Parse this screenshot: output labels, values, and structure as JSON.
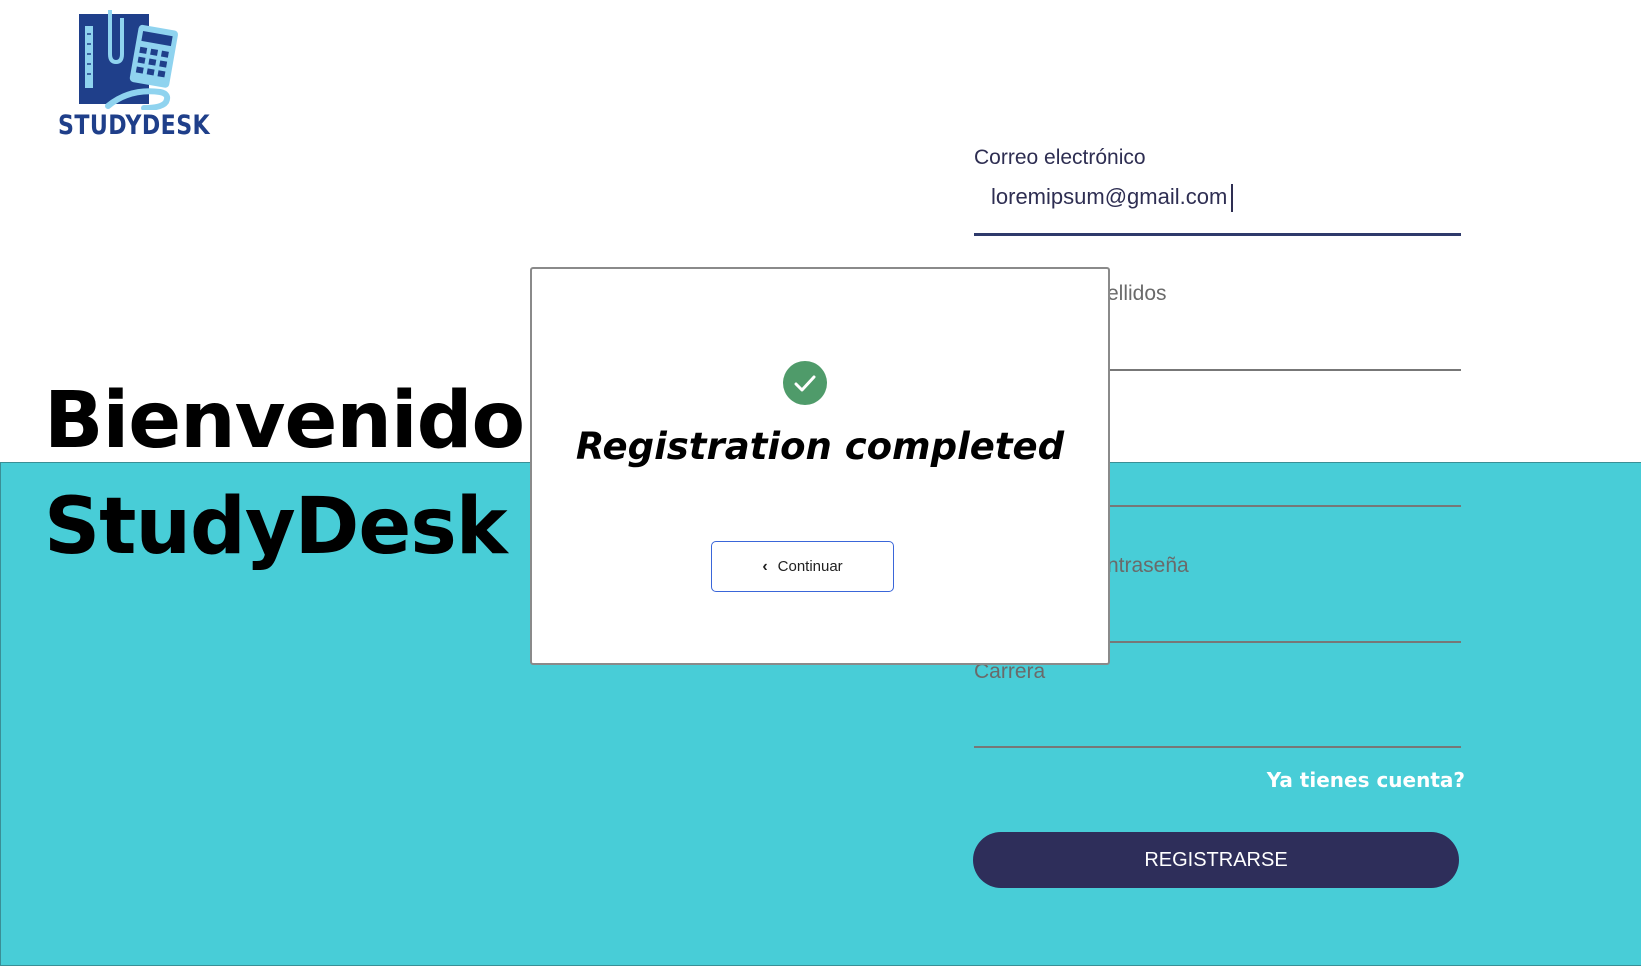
{
  "brand": {
    "logo_text": "STUDYDESK",
    "colors": {
      "logo_navy": "#1f3f8a",
      "logo_light_blue": "#8fd3ef",
      "teal_background": "#48CDD7",
      "primary_button": "#2e2e5a",
      "success_green": "#4f9b6a"
    }
  },
  "hero": {
    "line1": "Bienvenido a",
    "line2": "StudyDesk"
  },
  "form": {
    "email": {
      "label": "Correo electrónico",
      "value": "loremipsum@gmail.com"
    },
    "name_label_partial": "ellidos",
    "password_label_partial": "ntraseña",
    "career_label": "Carrera",
    "login_link": "Ya tienes cuenta?",
    "submit_label": "REGISTRARSE"
  },
  "modal": {
    "icon": "check-circle-icon",
    "title": "Registration completed",
    "continue_label": "Continuar",
    "continue_icon": "chevron-left-icon"
  }
}
